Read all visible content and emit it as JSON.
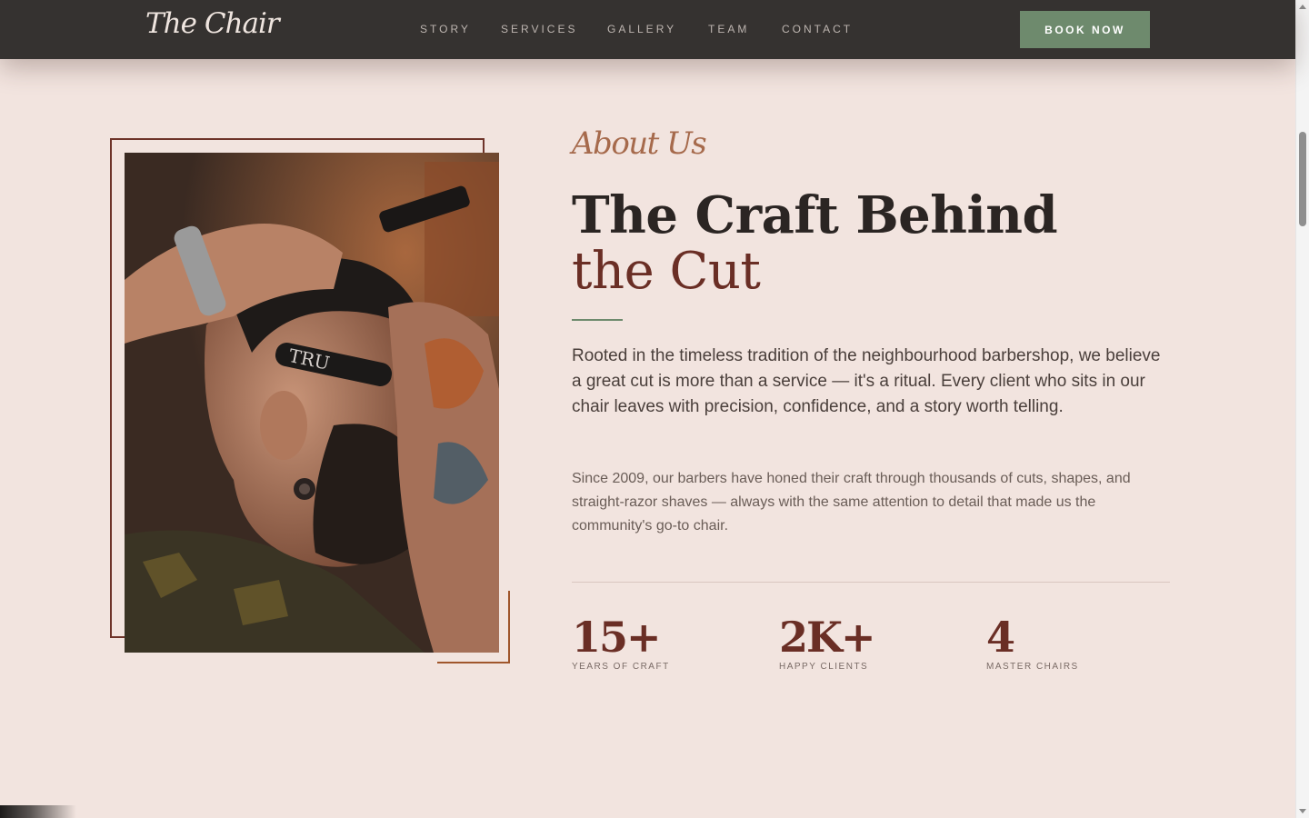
{
  "nav": {
    "logo": "The Chair",
    "links": [
      "STORY",
      "SERVICES",
      "GALLERY",
      "TEAM",
      "CONTACT"
    ],
    "cta": "BOOK NOW"
  },
  "about": {
    "eyebrow": "About Us",
    "headline_line1": "The Craft Behind",
    "headline_line2": "the Cut",
    "lead": "Rooted in the timeless tradition of the neighbourhood barbershop, we believe a great cut is more than a service — it's a ritual. Every client who sits in our chair leaves with precision, confidence, and a story worth telling.",
    "body": "Since 2009, our barbers have honed their craft through thousands of cuts, shapes, and straight-razor shaves — always with the same attention to detail that made us the community's go-to chair.",
    "photo_label": "TRU"
  },
  "stats": [
    {
      "value": "15+",
      "label": "YEARS OF CRAFT"
    },
    {
      "value": "2K+",
      "label": "HAPPY CLIENTS"
    },
    {
      "value": "4",
      "label": "MASTER CHAIRS"
    }
  ],
  "colors": {
    "background": "#f2e4df",
    "navbar": "#353230",
    "accent_green": "#6e8a6d",
    "accent_maroon": "#6a2e25",
    "eyebrow": "#a66a4c"
  }
}
